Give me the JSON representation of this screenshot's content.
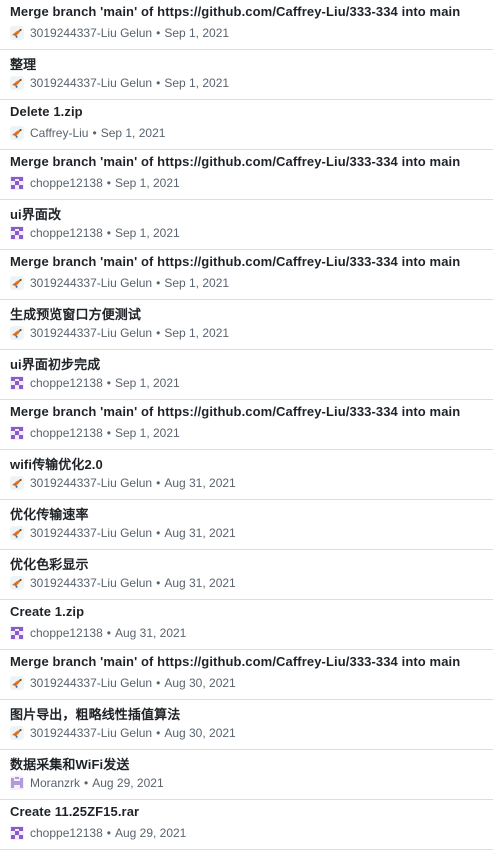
{
  "commits": [
    {
      "title": "Merge branch 'main' of https://github.com/Caffrey-Liu/333-334 into main",
      "author": "3019244337-Liu Gelun",
      "date": "Sep 1, 2021",
      "avatar": "bird-avatar-icon"
    },
    {
      "title": "整理",
      "author": "3019244337-Liu Gelun",
      "date": "Sep 1, 2021",
      "avatar": "bird-avatar-icon"
    },
    {
      "title": "Delete 1.zip",
      "author": "Caffrey-Liu",
      "date": "Sep 1, 2021",
      "avatar": "bird-avatar-icon"
    },
    {
      "title": "Merge branch 'main' of https://github.com/Caffrey-Liu/333-334 into main",
      "author": "choppe12138",
      "date": "Sep 1, 2021",
      "avatar": "identicon-purple-icon"
    },
    {
      "title": "ui界面改",
      "author": "choppe12138",
      "date": "Sep 1, 2021",
      "avatar": "identicon-purple-icon"
    },
    {
      "title": "Merge branch 'main' of https://github.com/Caffrey-Liu/333-334 into main",
      "author": "3019244337-Liu Gelun",
      "date": "Sep 1, 2021",
      "avatar": "bird-avatar-icon"
    },
    {
      "title": "生成预览窗口方便测试",
      "author": "3019244337-Liu Gelun",
      "date": "Sep 1, 2021",
      "avatar": "bird-avatar-icon"
    },
    {
      "title": "ui界面初步完成",
      "author": "choppe12138",
      "date": "Sep 1, 2021",
      "avatar": "identicon-purple-icon"
    },
    {
      "title": "Merge branch 'main' of https://github.com/Caffrey-Liu/333-334 into main",
      "author": "choppe12138",
      "date": "Sep 1, 2021",
      "avatar": "identicon-purple-icon"
    },
    {
      "title": "wifi传输优化2.0",
      "author": "3019244337-Liu Gelun",
      "date": "Aug 31, 2021",
      "avatar": "bird-avatar-icon"
    },
    {
      "title": "优化传输速率",
      "author": "3019244337-Liu Gelun",
      "date": "Aug 31, 2021",
      "avatar": "bird-avatar-icon"
    },
    {
      "title": "优化色彩显示",
      "author": "3019244337-Liu Gelun",
      "date": "Aug 31, 2021",
      "avatar": "bird-avatar-icon"
    },
    {
      "title": "Create 1.zip",
      "author": "choppe12138",
      "date": "Aug 31, 2021",
      "avatar": "identicon-purple-icon"
    },
    {
      "title": "Merge branch 'main' of https://github.com/Caffrey-Liu/333-334 into main",
      "author": "3019244337-Liu Gelun",
      "date": "Aug 30, 2021",
      "avatar": "bird-avatar-icon"
    },
    {
      "title": "图片导出，粗略线性插值算法",
      "author": "3019244337-Liu Gelun",
      "date": "Aug 30, 2021",
      "avatar": "bird-avatar-icon"
    },
    {
      "title": "数据采集和WiFi发送",
      "author": "Moranzrk",
      "date": "Aug 29, 2021",
      "avatar": "identicon-lavender-icon"
    },
    {
      "title": "Create 11.25ZF15.rar",
      "author": "choppe12138",
      "date": "Aug 29, 2021",
      "avatar": "identicon-purple-icon"
    }
  ],
  "separator": "•",
  "colors": {
    "title": "#1f2328",
    "meta": "#59636e",
    "divider": "#d8dee4",
    "identicon_purple": "#8a5cc8",
    "identicon_lavender": "#b19ad8",
    "bird_orange": "#e0701a"
  }
}
